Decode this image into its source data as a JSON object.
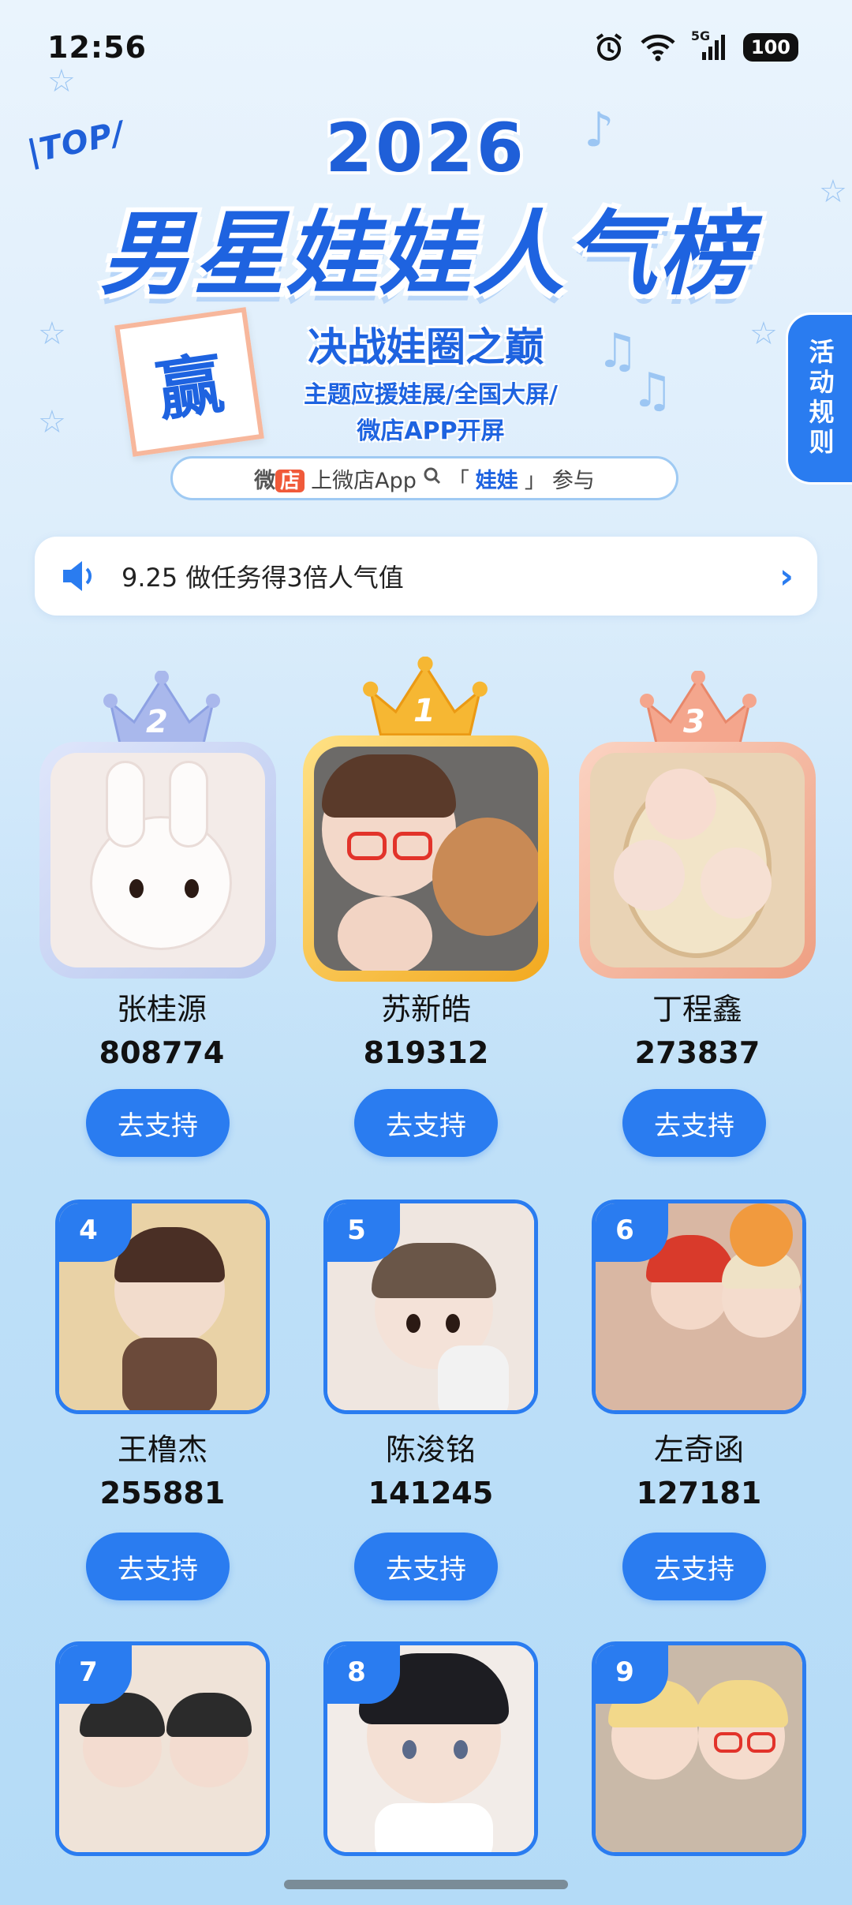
{
  "status_bar": {
    "time": "12:56",
    "network": "5G",
    "battery": "100"
  },
  "hero": {
    "top_tag": "TOP",
    "year": "2026",
    "title": "男星娃娃人气榜",
    "win_badge": "赢",
    "subtitle": "决战娃圈之巅",
    "line1": "主题应援娃展/全国大屏/",
    "line2": "微店APP开屏",
    "search": {
      "brand_prefix": "微",
      "brand_chip": "店",
      "text_before": "上微店App",
      "open_bracket": "「",
      "keyword": "娃娃",
      "close_bracket": "」",
      "text_after": "参与"
    }
  },
  "rules_tab": {
    "label": "活动规则"
  },
  "notice": {
    "text": "9.25 做任务得3倍人气值"
  },
  "top3": [
    {
      "rank": "2",
      "name": "张桂源",
      "votes": "808774",
      "button": "去支持"
    },
    {
      "rank": "1",
      "name": "苏新皓",
      "votes": "819312",
      "button": "去支持"
    },
    {
      "rank": "3",
      "name": "丁程鑫",
      "votes": "273837",
      "button": "去支持"
    }
  ],
  "grid": [
    {
      "rank": "4",
      "name": "王橹杰",
      "votes": "255881",
      "button": "去支持"
    },
    {
      "rank": "5",
      "name": "陈浚铭",
      "votes": "141245",
      "button": "去支持"
    },
    {
      "rank": "6",
      "name": "左奇函",
      "votes": "127181",
      "button": "去支持"
    },
    {
      "rank": "7"
    },
    {
      "rank": "8"
    },
    {
      "rank": "9"
    }
  ],
  "colors": {
    "accent": "#2a7cf0",
    "title_blue": "#1e63e0",
    "silver": "#b7c6ee",
    "gold": "#f5b531",
    "bronze": "#f2a58a"
  }
}
